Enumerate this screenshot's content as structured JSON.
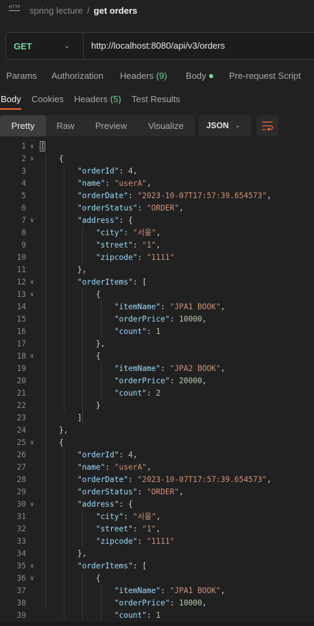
{
  "breadcrumb": {
    "icon": "http-request-icon",
    "icon_text": "HTTP",
    "collection": "spring lecture",
    "separator": "/",
    "request": "get orders"
  },
  "request": {
    "method": "GET",
    "url": "http://localhost:8080/api/v3/orders",
    "tabs": [
      {
        "label": "Params"
      },
      {
        "label": "Authorization"
      },
      {
        "label": "Headers",
        "count": "(9)"
      },
      {
        "label": "Body"
      },
      {
        "label": "Pre-request Script"
      }
    ]
  },
  "response": {
    "tabs": [
      {
        "label": "Body"
      },
      {
        "label": "Cookies"
      },
      {
        "label": "Headers",
        "count": "(5)"
      },
      {
        "label": "Test Results"
      }
    ],
    "views": [
      "Pretty",
      "Raw",
      "Preview",
      "Visualize"
    ],
    "active_view": "Pretty",
    "format": "JSON",
    "colors": {
      "accent": "#ff6c37",
      "method": "#6bdd9a",
      "key": "#9cdcfe",
      "string": "#ce9178",
      "number": "#b5cea8"
    }
  },
  "code_lines": [
    {
      "n": "1",
      "fold": true,
      "tokens": [
        [
          "p",
          "["
        ]
      ]
    },
    {
      "n": "2",
      "fold": true,
      "tokens": [
        [
          "p",
          "    {"
        ]
      ]
    },
    {
      "n": "3",
      "tokens": [
        [
          "p",
          "        "
        ],
        [
          "k",
          "\"orderId\""
        ],
        [
          "p",
          ": "
        ],
        [
          "n",
          "4"
        ],
        [
          "p",
          ","
        ]
      ]
    },
    {
      "n": "4",
      "tokens": [
        [
          "p",
          "        "
        ],
        [
          "k",
          "\"name\""
        ],
        [
          "p",
          ": "
        ],
        [
          "s",
          "\"userA\""
        ],
        [
          "p",
          ","
        ]
      ]
    },
    {
      "n": "5",
      "tokens": [
        [
          "p",
          "        "
        ],
        [
          "k",
          "\"orderDate\""
        ],
        [
          "p",
          ": "
        ],
        [
          "s",
          "\"2023-10-07T17:57:39.654573\""
        ],
        [
          "p",
          ","
        ]
      ]
    },
    {
      "n": "6",
      "tokens": [
        [
          "p",
          "        "
        ],
        [
          "k",
          "\"orderStatus\""
        ],
        [
          "p",
          ": "
        ],
        [
          "s",
          "\"ORDER\""
        ],
        [
          "p",
          ","
        ]
      ]
    },
    {
      "n": "7",
      "fold": true,
      "tokens": [
        [
          "p",
          "        "
        ],
        [
          "k",
          "\"address\""
        ],
        [
          "p",
          ": {"
        ]
      ]
    },
    {
      "n": "8",
      "tokens": [
        [
          "p",
          "            "
        ],
        [
          "k",
          "\"city\""
        ],
        [
          "p",
          ": "
        ],
        [
          "s",
          "\"서울\""
        ],
        [
          "p",
          ","
        ]
      ]
    },
    {
      "n": "9",
      "tokens": [
        [
          "p",
          "            "
        ],
        [
          "k",
          "\"street\""
        ],
        [
          "p",
          ": "
        ],
        [
          "s",
          "\"1\""
        ],
        [
          "p",
          ","
        ]
      ]
    },
    {
      "n": "10",
      "tokens": [
        [
          "p",
          "            "
        ],
        [
          "k",
          "\"zipcode\""
        ],
        [
          "p",
          ": "
        ],
        [
          "s",
          "\"1111\""
        ]
      ]
    },
    {
      "n": "11",
      "tokens": [
        [
          "p",
          "        },"
        ]
      ]
    },
    {
      "n": "12",
      "fold": true,
      "tokens": [
        [
          "p",
          "        "
        ],
        [
          "k",
          "\"orderItems\""
        ],
        [
          "p",
          ": ["
        ]
      ]
    },
    {
      "n": "13",
      "fold": true,
      "tokens": [
        [
          "p",
          "            {"
        ]
      ]
    },
    {
      "n": "14",
      "tokens": [
        [
          "p",
          "                "
        ],
        [
          "k",
          "\"itemName\""
        ],
        [
          "p",
          ": "
        ],
        [
          "s",
          "\"JPA1 BOOK\""
        ],
        [
          "p",
          ","
        ]
      ]
    },
    {
      "n": "15",
      "tokens": [
        [
          "p",
          "                "
        ],
        [
          "k",
          "\"orderPrice\""
        ],
        [
          "p",
          ": "
        ],
        [
          "n",
          "10000"
        ],
        [
          "p",
          ","
        ]
      ]
    },
    {
      "n": "16",
      "tokens": [
        [
          "p",
          "                "
        ],
        [
          "k",
          "\"count\""
        ],
        [
          "p",
          ": "
        ],
        [
          "n",
          "1"
        ]
      ]
    },
    {
      "n": "17",
      "tokens": [
        [
          "p",
          "            },"
        ]
      ]
    },
    {
      "n": "18",
      "fold": true,
      "tokens": [
        [
          "p",
          "            {"
        ]
      ]
    },
    {
      "n": "19",
      "tokens": [
        [
          "p",
          "                "
        ],
        [
          "k",
          "\"itemName\""
        ],
        [
          "p",
          ": "
        ],
        [
          "s",
          "\"JPA2 BOOK\""
        ],
        [
          "p",
          ","
        ]
      ]
    },
    {
      "n": "20",
      "tokens": [
        [
          "p",
          "                "
        ],
        [
          "k",
          "\"orderPrice\""
        ],
        [
          "p",
          ": "
        ],
        [
          "n",
          "20000"
        ],
        [
          "p",
          ","
        ]
      ]
    },
    {
      "n": "21",
      "tokens": [
        [
          "p",
          "                "
        ],
        [
          "k",
          "\"count\""
        ],
        [
          "p",
          ": "
        ],
        [
          "n",
          "2"
        ]
      ]
    },
    {
      "n": "22",
      "tokens": [
        [
          "p",
          "            }"
        ]
      ]
    },
    {
      "n": "23",
      "tokens": [
        [
          "p",
          "        ]"
        ]
      ]
    },
    {
      "n": "24",
      "tokens": [
        [
          "p",
          "    },"
        ]
      ]
    },
    {
      "n": "25",
      "fold": true,
      "tokens": [
        [
          "p",
          "    {"
        ]
      ]
    },
    {
      "n": "26",
      "tokens": [
        [
          "p",
          "        "
        ],
        [
          "k",
          "\"orderId\""
        ],
        [
          "p",
          ": "
        ],
        [
          "n",
          "4"
        ],
        [
          "p",
          ","
        ]
      ]
    },
    {
      "n": "27",
      "tokens": [
        [
          "p",
          "        "
        ],
        [
          "k",
          "\"name\""
        ],
        [
          "p",
          ": "
        ],
        [
          "s",
          "\"userA\""
        ],
        [
          "p",
          ","
        ]
      ]
    },
    {
      "n": "28",
      "tokens": [
        [
          "p",
          "        "
        ],
        [
          "k",
          "\"orderDate\""
        ],
        [
          "p",
          ": "
        ],
        [
          "s",
          "\"2023-10-07T17:57:39.654573\""
        ],
        [
          "p",
          ","
        ]
      ]
    },
    {
      "n": "29",
      "tokens": [
        [
          "p",
          "        "
        ],
        [
          "k",
          "\"orderStatus\""
        ],
        [
          "p",
          ": "
        ],
        [
          "s",
          "\"ORDER\""
        ],
        [
          "p",
          ","
        ]
      ]
    },
    {
      "n": "30",
      "fold": true,
      "tokens": [
        [
          "p",
          "        "
        ],
        [
          "k",
          "\"address\""
        ],
        [
          "p",
          ": {"
        ]
      ]
    },
    {
      "n": "31",
      "tokens": [
        [
          "p",
          "            "
        ],
        [
          "k",
          "\"city\""
        ],
        [
          "p",
          ": "
        ],
        [
          "s",
          "\"서울\""
        ],
        [
          "p",
          ","
        ]
      ]
    },
    {
      "n": "32",
      "tokens": [
        [
          "p",
          "            "
        ],
        [
          "k",
          "\"street\""
        ],
        [
          "p",
          ": "
        ],
        [
          "s",
          "\"1\""
        ],
        [
          "p",
          ","
        ]
      ]
    },
    {
      "n": "33",
      "tokens": [
        [
          "p",
          "            "
        ],
        [
          "k",
          "\"zipcode\""
        ],
        [
          "p",
          ": "
        ],
        [
          "s",
          "\"1111\""
        ]
      ]
    },
    {
      "n": "34",
      "tokens": [
        [
          "p",
          "        },"
        ]
      ]
    },
    {
      "n": "35",
      "fold": true,
      "tokens": [
        [
          "p",
          "        "
        ],
        [
          "k",
          "\"orderItems\""
        ],
        [
          "p",
          ": ["
        ]
      ]
    },
    {
      "n": "36",
      "fold": true,
      "tokens": [
        [
          "p",
          "            {"
        ]
      ]
    },
    {
      "n": "37",
      "tokens": [
        [
          "p",
          "                "
        ],
        [
          "k",
          "\"itemName\""
        ],
        [
          "p",
          ": "
        ],
        [
          "s",
          "\"JPA1 BOOK\""
        ],
        [
          "p",
          ","
        ]
      ]
    },
    {
      "n": "38",
      "tokens": [
        [
          "p",
          "                "
        ],
        [
          "k",
          "\"orderPrice\""
        ],
        [
          "p",
          ": "
        ],
        [
          "n",
          "10000"
        ],
        [
          "p",
          ","
        ]
      ]
    },
    {
      "n": "39",
      "tokens": [
        [
          "p",
          "                "
        ],
        [
          "k",
          "\"count\""
        ],
        [
          "p",
          ": "
        ],
        [
          "n",
          "1"
        ]
      ]
    }
  ]
}
